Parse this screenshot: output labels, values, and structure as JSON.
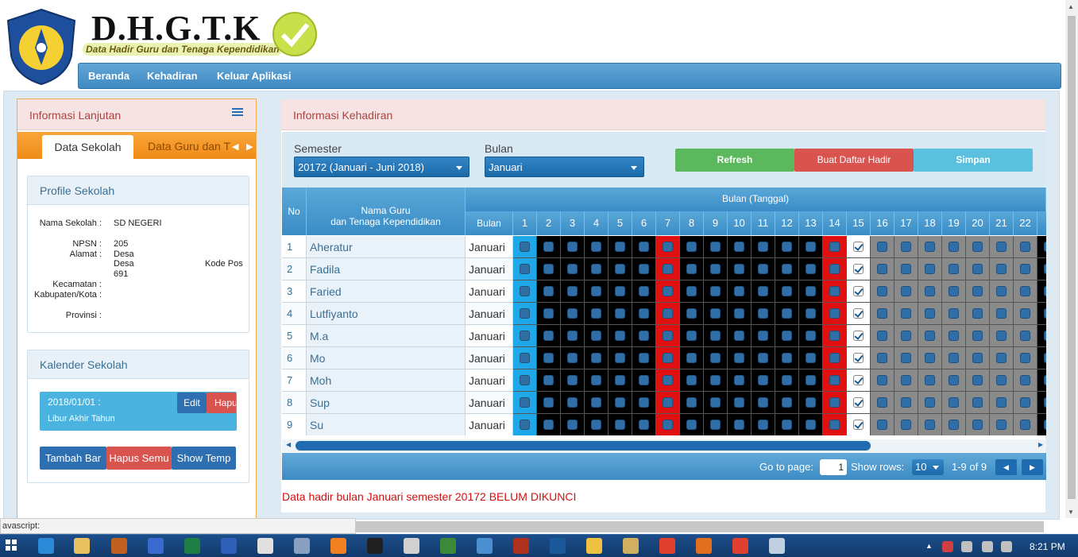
{
  "header": {
    "brand": "D.H.G.T.K",
    "brand_sub": "Data Hadir Guru dan Tenaga Kependidikan",
    "nav": [
      "Beranda",
      "Kehadiran",
      "Keluar Aplikasi"
    ]
  },
  "left": {
    "title": "Informasi Lanjutan",
    "tabs": [
      "Data Sekolah",
      "Data Guru dan T"
    ],
    "profile": {
      "title": "Profile Sekolah",
      "labels": [
        "Nama Sekolah :",
        "NPSN :",
        "Alamat :",
        "Kecamatan :",
        "Kabupaten/Kota :",
        "Provinsi :"
      ],
      "nama": "SD NEGERI",
      "npsn": "205",
      "alamat_1": "Desa",
      "alamat_2": "Desa",
      "alamat_2b": "Kode Pos",
      "alamat_3": "691"
    },
    "calendar": {
      "title": "Kalender Sekolah",
      "date": "2018/01/01 :",
      "desc": "Libur Akhir Tahun",
      "edit": "Edit",
      "hapus": "Hapu",
      "buttons": [
        "Tambah Bar",
        "Hapus Semu",
        "Show Temp"
      ]
    }
  },
  "right": {
    "title": "Informasi Kehadiran",
    "semester_label": "Semester",
    "semester_value": "20172 (Januari - Juni 2018)",
    "bulan_label": "Bulan",
    "bulan_value": "Januari",
    "buttons": {
      "refresh": "Refresh",
      "buat": "Buat Daftar Hadir",
      "simpan": "Simpan"
    },
    "grid": {
      "col_no": "No",
      "col_nama": "Nama Guru\ndan Tenaga Kependidikan",
      "group_header": "Bulan (Tanggal)",
      "col_bulan": "Bulan",
      "days": [
        "1",
        "2",
        "3",
        "4",
        "5",
        "6",
        "7",
        "8",
        "9",
        "10",
        "11",
        "12",
        "13",
        "14",
        "15",
        "16",
        "17",
        "18",
        "19",
        "20",
        "21",
        "22",
        "2"
      ],
      "rows": [
        {
          "no": "1",
          "nama": "Aheratur",
          "bulan": "Januari"
        },
        {
          "no": "2",
          "nama": "Fadila",
          "bulan": "Januari"
        },
        {
          "no": "3",
          "nama": "Faried",
          "bulan": "Januari"
        },
        {
          "no": "4",
          "nama": "Lutfiyanto",
          "bulan": "Januari"
        },
        {
          "no": "5",
          "nama": "M.a",
          "bulan": "Januari"
        },
        {
          "no": "6",
          "nama": "Mo",
          "bulan": "Januari"
        },
        {
          "no": "7",
          "nama": "Moh",
          "bulan": "Januari"
        },
        {
          "no": "8",
          "nama": "Sup",
          "bulan": "Januari"
        },
        {
          "no": "9",
          "nama": "Su",
          "bulan": "Januari"
        }
      ],
      "checked_day": "15"
    },
    "pager": {
      "goto_label": "Go to page:",
      "goto_value": "1",
      "rows_label": "Show rows:",
      "rows_value": "10",
      "range": "1-9 of 9"
    },
    "message": "Data hadir bulan Januari semester 20172 BELUM DIKUNCI"
  },
  "statusbar": "avascript:",
  "clock": "8:21 PM",
  "colors": {
    "weekday": "#000000",
    "holiday": "#e01010",
    "today": "#1ea8e8",
    "future": "#8a8a8a",
    "nav": "#4b95cc"
  }
}
